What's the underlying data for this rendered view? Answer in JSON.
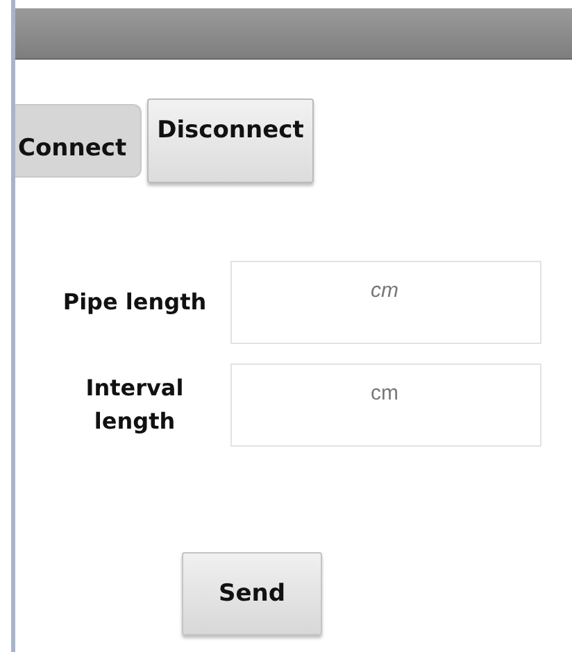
{
  "connection_buttons": [
    {
      "label": "Connect",
      "selected": true
    },
    {
      "label": "Disconnect",
      "selected": false
    }
  ],
  "fields": [
    {
      "label": "Pipe length",
      "placeholder": "cm"
    },
    {
      "label": "Interval length",
      "placeholder": "cm"
    }
  ],
  "send_button": {
    "label": "Send"
  }
}
